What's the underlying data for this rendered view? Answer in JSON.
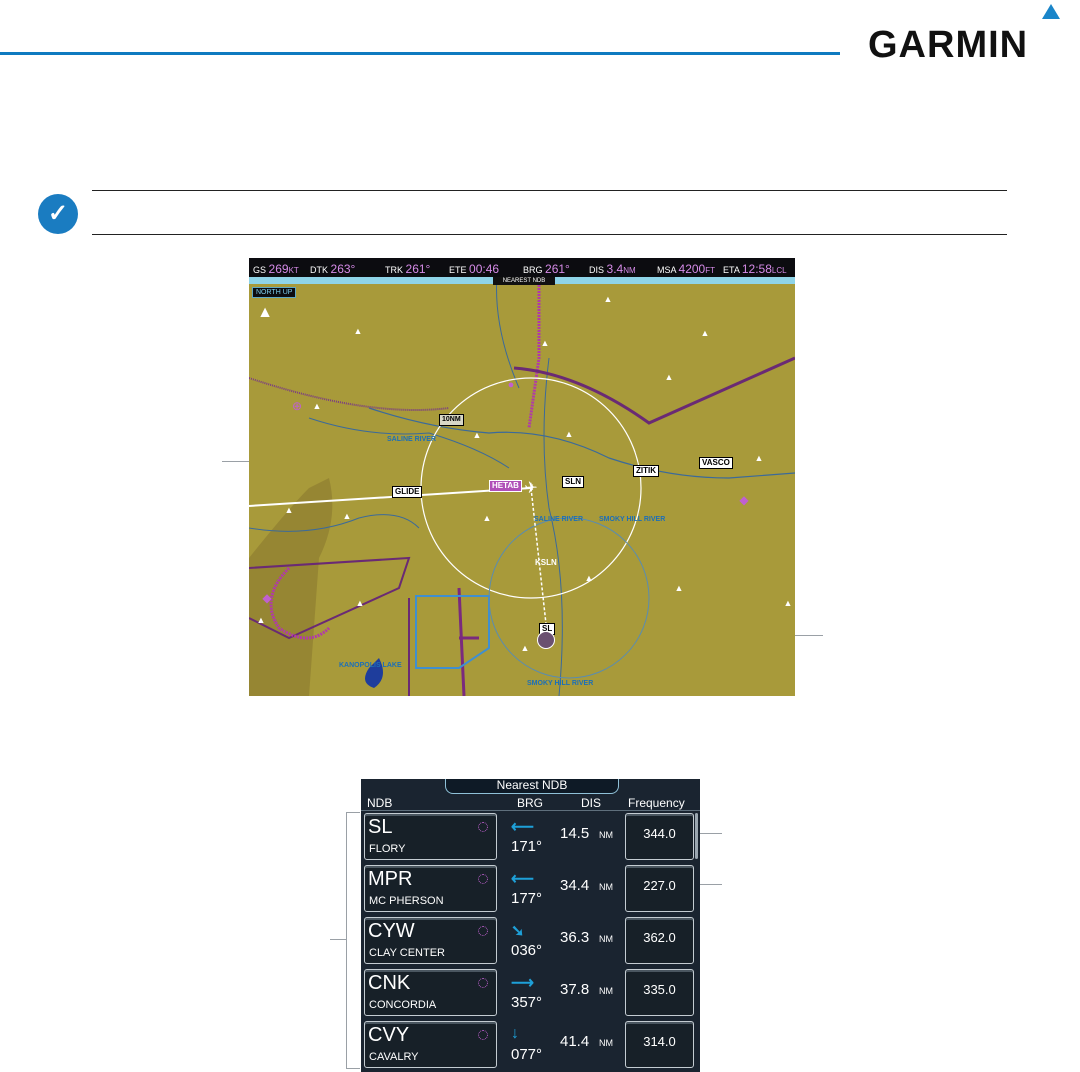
{
  "header": {
    "logo_text": "GARMIN",
    "accent_color": "#0f7ac0"
  },
  "note": {
    "icon": "checkmark-note-icon"
  },
  "map": {
    "topbar": [
      {
        "label": "GS",
        "value": "269",
        "unit": "KT"
      },
      {
        "label": "DTK",
        "value": "263°",
        "unit": ""
      },
      {
        "label": "TRK",
        "value": "261°",
        "unit": ""
      },
      {
        "label": "ETE",
        "value": "00:46",
        "unit": ""
      },
      {
        "label": "BRG",
        "value": "261°",
        "unit": ""
      },
      {
        "label": "DIS",
        "value": "3.4",
        "unit": "NM"
      },
      {
        "label": "MSA",
        "value": "4200",
        "unit": "FT"
      },
      {
        "label": "ETA",
        "value": "12:58",
        "unit": "LCL"
      }
    ],
    "page_title": "NEAREST NDB",
    "orientation": "NORTH UP",
    "range": "10NM",
    "waypoints": {
      "glide": "GLIDE",
      "hetab": "HETAB",
      "sln": "SLN",
      "zitik": "ZITIK",
      "vasco": "VASCO",
      "ksln": "KSLN",
      "sl": "SL"
    },
    "rivers": {
      "north": "SALINE RIVER",
      "south": "SMOKY HILL RIVER",
      "mid": "SMOKY HILL RIVER",
      "saline_area": "SALINE RIVER",
      "lake": "KANOPOLIS LAKE"
    }
  },
  "nearest_ndb": {
    "title": "Nearest NDB",
    "columns": {
      "ndb": "NDB",
      "brg": "BRG",
      "dis": "DIS",
      "freq": "Frequency"
    },
    "rows": [
      {
        "id": "SL",
        "name": "FLORY",
        "arrow": "⟵",
        "brg": "171°",
        "dis": "14.5",
        "unit": "NM",
        "freq": "344.0"
      },
      {
        "id": "MPR",
        "name": "MC PHERSON",
        "arrow": "⟵",
        "brg": "177°",
        "dis": "34.4",
        "unit": "NM",
        "freq": "227.0"
      },
      {
        "id": "CYW",
        "name": "CLAY CENTER",
        "arrow": "➘",
        "brg": "036°",
        "dis": "36.3",
        "unit": "NM",
        "freq": "362.0"
      },
      {
        "id": "CNK",
        "name": "CONCORDIA",
        "arrow": "⟶",
        "brg": "357°",
        "dis": "37.8",
        "unit": "NM",
        "freq": "335.0"
      },
      {
        "id": "CVY",
        "name": "CAVALRY",
        "arrow": "↓",
        "brg": "077°",
        "dis": "41.4",
        "unit": "NM",
        "freq": "314.0"
      }
    ]
  }
}
